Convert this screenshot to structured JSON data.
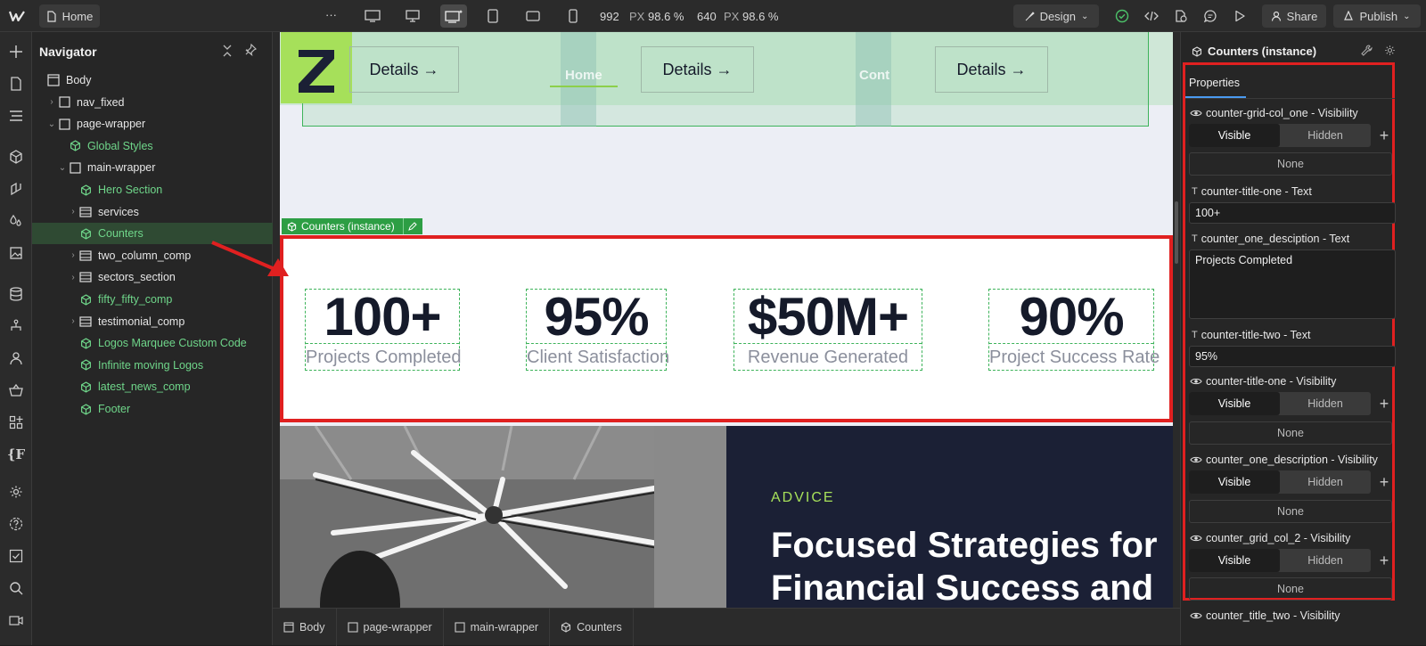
{
  "topbar": {
    "home_label": "Home",
    "more_label": "···",
    "width_value": "992",
    "width_unit": "PX",
    "width_zoom": "98.6 %",
    "height_value": "640",
    "height_unit": "PX",
    "height_zoom": "98.6 %",
    "design_label": "Design",
    "share_label": "Share",
    "publish_label": "Publish"
  },
  "navigator": {
    "title": "Navigator",
    "items": [
      {
        "label": "Body",
        "depth": 0,
        "icon": "body-icon",
        "component": false,
        "caret": ""
      },
      {
        "label": "nav_fixed",
        "depth": 1,
        "icon": "box-icon",
        "component": false,
        "caret": "›"
      },
      {
        "label": "page-wrapper",
        "depth": 1,
        "icon": "box-icon",
        "component": false,
        "caret": "⌄"
      },
      {
        "label": "Global Styles",
        "depth": 2,
        "icon": "component-icon",
        "component": true,
        "caret": ""
      },
      {
        "label": "main-wrapper",
        "depth": 2,
        "icon": "box-icon",
        "component": false,
        "caret": "⌄"
      },
      {
        "label": "Hero Section",
        "depth": 3,
        "icon": "component-icon",
        "component": true,
        "caret": ""
      },
      {
        "label": "services",
        "depth": 3,
        "icon": "section-icon",
        "component": false,
        "caret": "›"
      },
      {
        "label": "Counters",
        "depth": 3,
        "icon": "component-icon",
        "component": true,
        "caret": "",
        "selected": true
      },
      {
        "label": "two_column_comp",
        "depth": 3,
        "icon": "section-icon",
        "component": false,
        "caret": "›"
      },
      {
        "label": "sectors_section",
        "depth": 3,
        "icon": "section-icon",
        "component": false,
        "caret": "›"
      },
      {
        "label": "fifty_fifty_comp",
        "depth": 3,
        "icon": "component-icon",
        "component": true,
        "caret": ""
      },
      {
        "label": "testimonial_comp",
        "depth": 3,
        "icon": "section-icon",
        "component": false,
        "caret": "›"
      },
      {
        "label": "Logos Marquee Custom Code",
        "depth": 3,
        "icon": "component-icon",
        "component": true,
        "caret": ""
      },
      {
        "label": "Infinite moving Logos",
        "depth": 3,
        "icon": "component-icon",
        "component": true,
        "caret": ""
      },
      {
        "label": "latest_news_comp",
        "depth": 3,
        "icon": "component-icon",
        "component": true,
        "caret": ""
      },
      {
        "label": "Footer",
        "depth": 3,
        "icon": "component-icon",
        "component": true,
        "caret": ""
      }
    ]
  },
  "canvas": {
    "header_buttons": [
      "Details →",
      "Details →",
      "Details →"
    ],
    "header_nav_ghost": [
      "Home",
      "Cont"
    ],
    "instance_tag": "Counters (instance)",
    "counters": [
      {
        "value": "100+",
        "label": "Projects Completed"
      },
      {
        "value": "95%",
        "label": "Client Satisfaction"
      },
      {
        "value": "$50M+",
        "label": "Revenue Generated"
      },
      {
        "value": "90%",
        "label": "Project Success Rate"
      }
    ],
    "advice_eyebrow": "ADVICE",
    "advice_heading_line1": "Focused Strategies for",
    "advice_heading_line2": "Financial Success and"
  },
  "breadcrumb": [
    "Body",
    "page-wrapper",
    "main-wrapper",
    "Counters"
  ],
  "panel": {
    "title": "Counters (instance)",
    "tab": "Properties",
    "visible": "Visible",
    "hidden": "Hidden",
    "none": "None",
    "props": {
      "p1": "counter-grid-col_one - Visibility",
      "p2": "counter-title-one - Text",
      "p2_value": "100+",
      "p3": "counter_one_desciption - Text",
      "p3_value": "Projects Completed",
      "p4": "counter-title-two - Text",
      "p4_value": "95%",
      "p5": "counter-title-one - Visibility",
      "p6": "counter_one_description - Visibility",
      "p7": "counter_grid_col_2 - Visibility",
      "p8": "counter_title_two - Visibility"
    }
  },
  "colors": {
    "accent_red": "#e02020",
    "webflow_green": "#2d9e44",
    "lime": "#a6e05a",
    "navy": "#1b2035"
  }
}
